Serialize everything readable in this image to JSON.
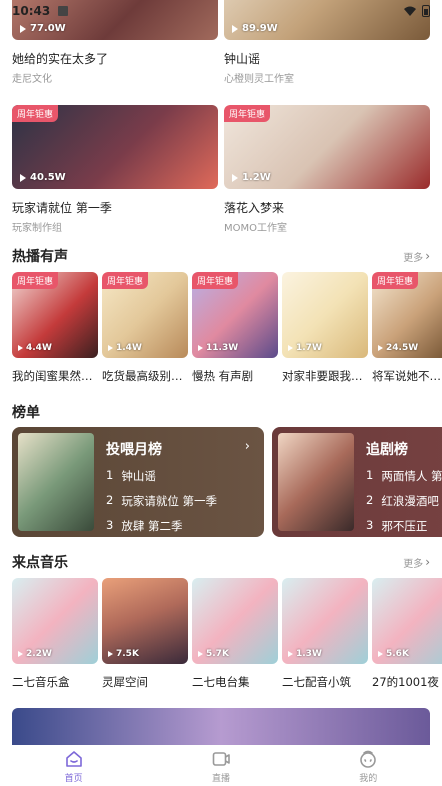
{
  "status_bar": {
    "time": "10:43"
  },
  "top_row": [
    {
      "title": "她给的实在太多了",
      "sub": "走尼文化",
      "count": "77.0W"
    },
    {
      "title": "钟山谣",
      "sub": "心橙则灵工作室",
      "count": "89.9W"
    }
  ],
  "second_row": [
    {
      "title": "玩家请就位 第一季",
      "sub": "玩家制作组",
      "count": "40.5W",
      "badge": "周年钜惠"
    },
    {
      "title": "落花入梦来",
      "sub": "MOMO工作室",
      "count": "1.2W",
      "badge": "周年钜惠"
    }
  ],
  "hot": {
    "title": "热播有声",
    "more": "更多",
    "items": [
      {
        "title": "我的闺蜜果然…",
        "count": "4.4W",
        "badge": "周年钜惠"
      },
      {
        "title": "吃货最高级别…",
        "count": "1.4W",
        "badge": "周年钜惠"
      },
      {
        "title": "慢热 有声剧",
        "count": "11.3W",
        "badge": "周年钜惠"
      },
      {
        "title": "对家非要跟我…",
        "count": "1.7W",
        "badge": ""
      },
      {
        "title": "将军说她不…",
        "count": "24.5W",
        "badge": "周年钜惠"
      }
    ]
  },
  "ranking": {
    "title": "榜单",
    "cards": [
      {
        "name": "投喂月榜",
        "items": [
          {
            "n": "1",
            "t": "钟山谣"
          },
          {
            "n": "2",
            "t": "玩家请就位 第一季"
          },
          {
            "n": "3",
            "t": "放肆 第二季"
          }
        ]
      },
      {
        "name": "追剧榜",
        "items": [
          {
            "n": "1",
            "t": "两面情人 第"
          },
          {
            "n": "2",
            "t": "红浪漫酒吧"
          },
          {
            "n": "3",
            "t": "邪不压正"
          }
        ]
      }
    ]
  },
  "music": {
    "title": "来点音乐",
    "more": "更多",
    "items": [
      {
        "title": "二七音乐盒",
        "count": "2.2W"
      },
      {
        "title": "灵犀空间",
        "count": "7.5K"
      },
      {
        "title": "二七电台集",
        "count": "5.7K"
      },
      {
        "title": "二七配音小筑",
        "count": "1.3W"
      },
      {
        "title": "27的1001夜",
        "count": "5.6K"
      }
    ]
  },
  "tabs": [
    {
      "label": "首页"
    },
    {
      "label": "直播"
    },
    {
      "label": "我的"
    }
  ],
  "colors": {
    "accent": "#7d68d8",
    "badge": "#e8566a"
  }
}
